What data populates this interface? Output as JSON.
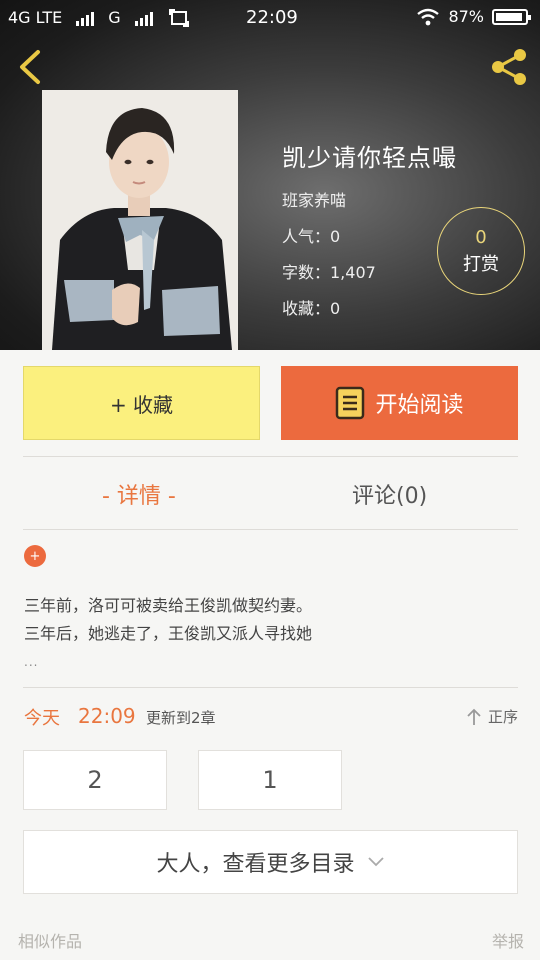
{
  "status_bar": {
    "network1": "4G LTE",
    "network2": "G",
    "time": "22:09",
    "battery": "87%"
  },
  "book": {
    "title": "凯少请你轻点嘬",
    "author": "班家养喵",
    "popularity": "人气：0",
    "word_count": "字数：1,407",
    "collections": "收藏：0"
  },
  "reward": {
    "count": "0",
    "label": "打赏"
  },
  "actions": {
    "collect_label": "+ 收藏",
    "read_label": "开始阅读"
  },
  "tabs": {
    "detail": "- 详情 -",
    "comment": "评论(0)"
  },
  "badge": "+",
  "description": {
    "line1": "三年前，洛可可被卖给王俊凯做契约妻。",
    "line2": "三年后，她逃走了，王俊凯又派人寻找她",
    "more": "..."
  },
  "update": {
    "day": "今天",
    "time": "22:09",
    "text": "更新到2章",
    "sort_label": "正序"
  },
  "chapters": [
    "2",
    "1"
  ],
  "more_catalog": "大人，查看更多目录",
  "footer": {
    "similar": "相似作品",
    "report": "举报"
  },
  "colors": {
    "accent_orange": "#ec6a3e",
    "collect_yellow": "#fbf07e",
    "reward_gold": "#e9d57a"
  }
}
